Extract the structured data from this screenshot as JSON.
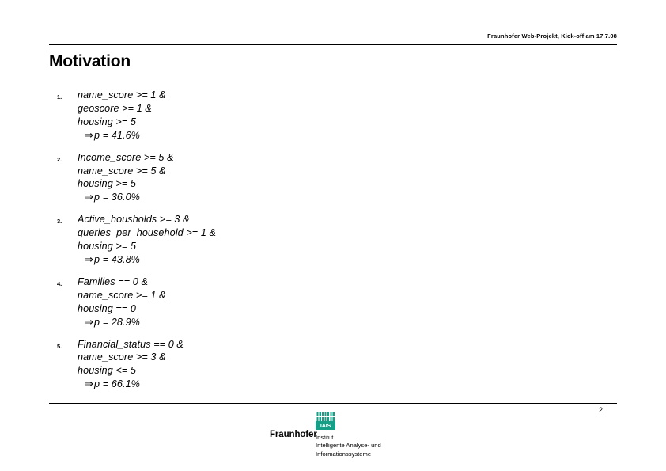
{
  "header": {
    "text": "Fraunhofer Web-Projekt, Kick-off am 17.7.08"
  },
  "title": "Motivation",
  "arrow_glyph": "⇒",
  "rules": [
    {
      "index": "1.",
      "conditions": [
        "name_score >= 1 &",
        "geoscore >= 1 &",
        "housing >= 5"
      ],
      "probability": "p =  41.6%"
    },
    {
      "index": "2.",
      "conditions": [
        "Income_score >= 5 &",
        "name_score >= 5 &",
        "housing >= 5"
      ],
      "probability": "p = 36.0%"
    },
    {
      "index": "3.",
      "conditions": [
        "Active_housholds  >= 3 &",
        "queries_per_household >= 1 &",
        "housing >= 5"
      ],
      "probability": "p = 43.8%"
    },
    {
      "index": "4.",
      "conditions": [
        "Families == 0 &",
        "name_score >= 1 &",
        "housing == 0"
      ],
      "probability": "p = 28.9%"
    },
    {
      "index": "5.",
      "conditions": [
        "Financial_status == 0 &",
        "name_score >= 3 &",
        "housing <= 5"
      ],
      "probability": "p = 66.1%"
    }
  ],
  "footer": {
    "page_number": "2",
    "logo": {
      "brand": "Fraunhofer",
      "mark_label": "IAIS",
      "mark_color": "#179e86",
      "institute_lines": [
        "Institut",
        "Intelligente Analyse- und",
        "Informationssysteme"
      ]
    }
  }
}
